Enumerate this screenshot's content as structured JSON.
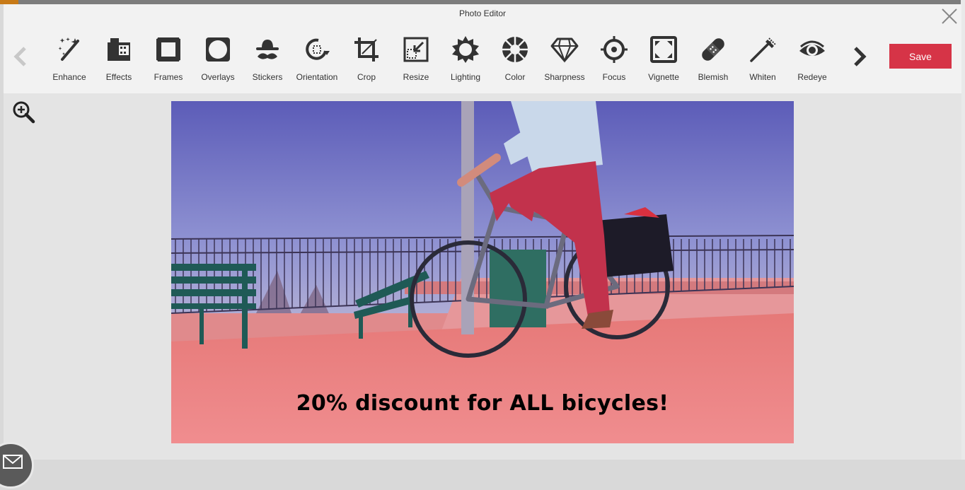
{
  "window": {
    "title": "Photo Editor"
  },
  "toolbar": {
    "tools": [
      {
        "label": "Enhance",
        "icon": "magic-wand-icon"
      },
      {
        "label": "Effects",
        "icon": "film-icon"
      },
      {
        "label": "Frames",
        "icon": "frame-icon"
      },
      {
        "label": "Overlays",
        "icon": "overlay-icon"
      },
      {
        "label": "Stickers",
        "icon": "hat-mustache-icon"
      },
      {
        "label": "Orientation",
        "icon": "rotate-icon"
      },
      {
        "label": "Crop",
        "icon": "crop-icon"
      },
      {
        "label": "Resize",
        "icon": "resize-icon"
      },
      {
        "label": "Lighting",
        "icon": "sun-icon"
      },
      {
        "label": "Color",
        "icon": "color-wheel-icon"
      },
      {
        "label": "Sharpness",
        "icon": "diamond-icon"
      },
      {
        "label": "Focus",
        "icon": "crosshair-icon"
      },
      {
        "label": "Vignette",
        "icon": "vignette-icon"
      },
      {
        "label": "Blemish",
        "icon": "bandage-icon"
      },
      {
        "label": "Whiten",
        "icon": "toothbrush-icon"
      },
      {
        "label": "Redeye",
        "icon": "eye-icon"
      }
    ],
    "save_label": "Save"
  },
  "canvas": {
    "caption": "20% discount for ALL bicycles!"
  },
  "colors": {
    "accent": "#d63447",
    "toolbar_bg": "#f2f2f2",
    "canvas_bg": "#e4e4e4",
    "icon": "#333333"
  }
}
